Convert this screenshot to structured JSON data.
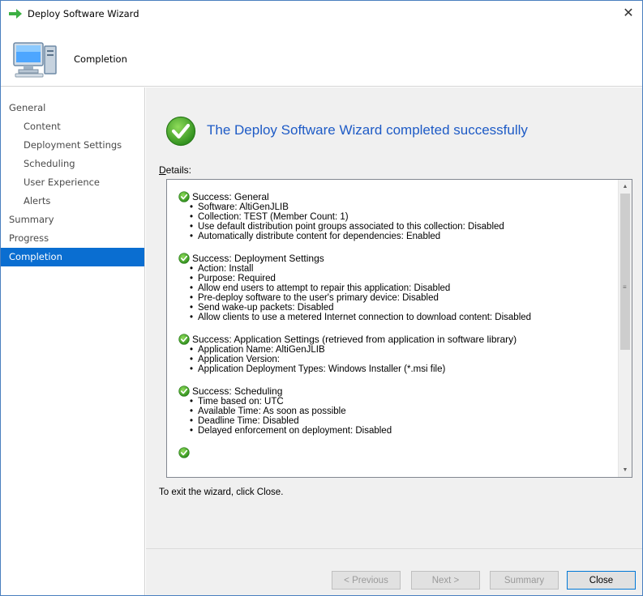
{
  "window": {
    "title": "Deploy Software Wizard",
    "close_symbol": "✕"
  },
  "header": {
    "title": "Completion",
    "icon": "computer-icon"
  },
  "nav": {
    "items": [
      {
        "label": "General",
        "level": 0,
        "active": false
      },
      {
        "label": "Content",
        "level": 1,
        "active": false
      },
      {
        "label": "Deployment Settings",
        "level": 1,
        "active": false
      },
      {
        "label": "Scheduling",
        "level": 1,
        "active": false
      },
      {
        "label": "User Experience",
        "level": 1,
        "active": false
      },
      {
        "label": "Alerts",
        "level": 1,
        "active": false
      },
      {
        "label": "Summary",
        "level": 0,
        "active": false
      },
      {
        "label": "Progress",
        "level": 0,
        "active": false
      },
      {
        "label": "Completion",
        "level": 0,
        "active": true
      }
    ]
  },
  "main": {
    "success_title": "The Deploy Software Wizard completed successfully",
    "details_label": "Details:",
    "exit_text": "To exit the wizard, click Close.",
    "sections": [
      {
        "heading": "Success: General",
        "items": [
          "Software: AltiGenJLIB",
          "Collection: TEST (Member Count: 1)",
          "Use default distribution point groups associated to this collection: Disabled",
          "Automatically distribute content for dependencies: Enabled"
        ]
      },
      {
        "heading": "Success: Deployment Settings",
        "items": [
          "Action: Install",
          "Purpose: Required",
          "Allow end users to attempt to repair this application: Disabled",
          "Pre-deploy software to the user's primary device: Disabled",
          "Send wake-up packets: Disabled",
          "Allow clients to use a metered Internet connection to download content: Disabled"
        ]
      },
      {
        "heading": "Success: Application Settings (retrieved from application in software library)",
        "items": [
          "Application Name: AltiGenJLIB",
          "Application Version:",
          "Application Deployment Types: Windows Installer (*.msi file)"
        ]
      },
      {
        "heading": "Success: Scheduling",
        "items": [
          "Time based on: UTC",
          "Available Time: As soon as possible",
          "Deadline Time: Disabled",
          "Delayed enforcement on deployment: Disabled"
        ]
      }
    ],
    "scroll_grip": "≡"
  },
  "footer": {
    "previous_label": "< Previous",
    "next_label": "Next >",
    "summary_label": "Summary",
    "close_label": "Close"
  },
  "colors": {
    "accent": "#0a6ed1",
    "title_blue": "#1e5bc6",
    "success_green": "#4caf28"
  }
}
